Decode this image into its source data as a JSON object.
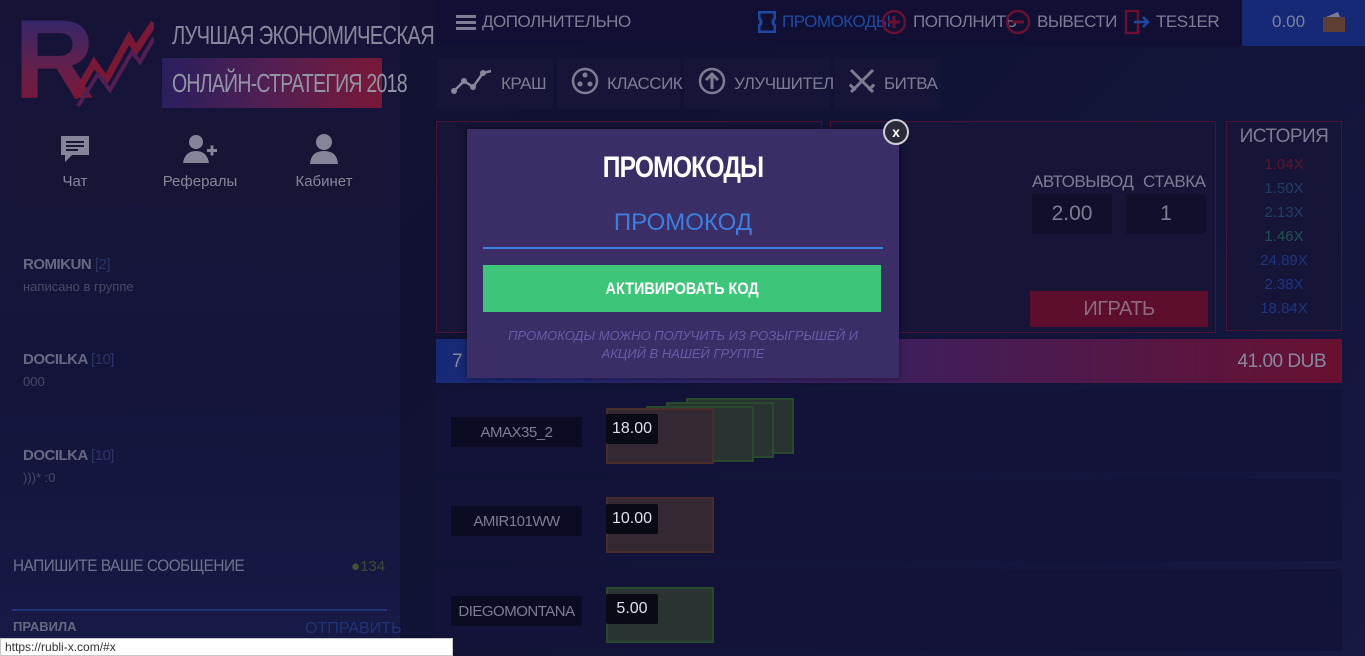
{
  "header": {
    "slogan_line1": "ЛУЧШАЯ ЭКОНОМИЧЕСКАЯ",
    "slogan_line2": "ОНЛАЙН-СТРАТЕГИЯ 2018"
  },
  "sidebar": {
    "nav": [
      {
        "label": "Чат",
        "icon": "chat-icon"
      },
      {
        "label": "Рефералы",
        "icon": "add-user-icon"
      },
      {
        "label": "Кабинет",
        "icon": "user-icon"
      }
    ],
    "messages": [
      {
        "user": "ROMIKUN",
        "level": "[2]",
        "text": "написано в группе"
      },
      {
        "user": "DOCILKA",
        "level": "[10]",
        "text": "000"
      },
      {
        "user": "DOCILKA",
        "level": "[10]",
        "text": ")))* :0"
      }
    ],
    "message_placeholder": "НАПИШИТЕ ВАШЕ СООБЩЕНИЕ",
    "online_count": "134",
    "rules_label": "ПРАВИЛА",
    "send_label": "ОТПРАВИТЬ"
  },
  "topbar": {
    "more_label": "ДОПОЛНИТЕЛЬНО",
    "promo_label": "ПРОМОКОДЫ",
    "deposit_label": "ПОПОЛНИТЬ",
    "withdraw_label": "ВЫВЕСТИ",
    "username": "TES1ER",
    "balance": "0.00"
  },
  "game_tabs": [
    {
      "label": "КРАШ",
      "icon": "crash-chart-icon"
    },
    {
      "label": "КЛАССИК",
      "icon": "classic-icon"
    },
    {
      "label": "УЛУЧШИТЕЛЬ",
      "icon": "upgrade-arrow-icon"
    },
    {
      "label": "БИТВА",
      "icon": "crossed-swords-icon"
    }
  ],
  "controls": {
    "autowithdraw_label": "АВТОВЫВОД",
    "autowithdraw_value": "2.00",
    "bet_label": "СТАВКА",
    "bet_value": "1",
    "play_label": "ИГРАТЬ"
  },
  "history": {
    "title": "ИСТОРИЯ",
    "items": [
      {
        "value": "1.04X",
        "color": "#8a1a2a"
      },
      {
        "value": "1.50X",
        "color": "#2a5a8a"
      },
      {
        "value": "2.13X",
        "color": "#2a5a8a"
      },
      {
        "value": "1.46X",
        "color": "#2a7a6a"
      },
      {
        "value": "24.89X",
        "color": "#2a4ab4"
      },
      {
        "value": "2.38X",
        "color": "#2a4ab4"
      },
      {
        "value": "18.84X",
        "color": "#2a4ab4"
      }
    ]
  },
  "bets": {
    "count": "7",
    "total": "41.00 DUB",
    "rows": [
      {
        "user": "AMAX35_2",
        "amount": "18.00"
      },
      {
        "user": "AMIR101WW",
        "amount": "10.00"
      },
      {
        "user": "DIEGOMONTANA",
        "amount": "5.00"
      }
    ]
  },
  "modal": {
    "title": "ПРОМОКОДЫ",
    "input_placeholder": "ПРОМОКОД",
    "activate_label": "АКТИВИРОВАТЬ КОД",
    "note": "ПРОМОКОДЫ МОЖНО ПОЛУЧИТЬ ИЗ РОЗЫГРЫШЕЙ И АКЦИЙ В НАШЕЙ ГРУППЕ",
    "close_label": "x"
  },
  "status_url": "https://rubli-x.com/#x",
  "colors": {
    "accent_blue": "#3b7fe0",
    "activate_green": "#3dc57a",
    "modal_bg": "#3b2d66",
    "play_red": "#8a1030"
  }
}
